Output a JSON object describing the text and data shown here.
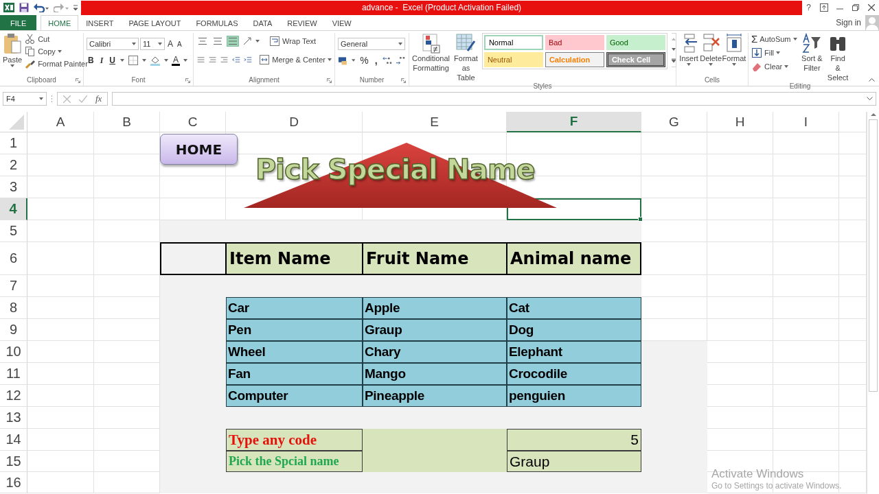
{
  "window": {
    "title": "advance -  Excel (Product Activation Failed)",
    "help": "?"
  },
  "ribbon_tabs": [
    {
      "label": "FILE",
      "kind": "file",
      "selected": false
    },
    {
      "label": "HOME",
      "kind": "tab",
      "selected": true
    },
    {
      "label": "INSERT",
      "kind": "tab",
      "selected": false
    },
    {
      "label": "PAGE LAYOUT",
      "kind": "tab",
      "selected": false
    },
    {
      "label": "FORMULAS",
      "kind": "tab",
      "selected": false
    },
    {
      "label": "DATA",
      "kind": "tab",
      "selected": false
    },
    {
      "label": "REVIEW",
      "kind": "tab",
      "selected": false
    },
    {
      "label": "VIEW",
      "kind": "tab",
      "selected": false
    }
  ],
  "account": {
    "label": "Sign in"
  },
  "clipboard": {
    "paste": "Paste",
    "cut": "Cut",
    "copy": "Copy",
    "format_painter": "Format Painter",
    "label": "Clipboard"
  },
  "font": {
    "name": "Calibri",
    "size": "11",
    "grow": "A",
    "shrink": "A",
    "bold": "B",
    "italic": "I",
    "underline": "U",
    "font_color": "A",
    "label": "Font"
  },
  "alignment": {
    "vertical_align": [
      {
        "selected": false
      },
      {
        "selected": false
      },
      {
        "selected": true
      }
    ],
    "wrap_text": "Wrap Text",
    "merge": "Merge & Center",
    "label": "Alignment"
  },
  "number": {
    "format": "General",
    "percent": "%",
    "comma": ",",
    "label": "Number"
  },
  "styles": {
    "conditional": "Conditional Formatting",
    "table": "Format as Table",
    "label": "Styles",
    "cells": [
      {
        "label": "Normal",
        "kind": "normal"
      },
      {
        "label": "Bad",
        "kind": "bad"
      },
      {
        "label": "Good",
        "kind": "good"
      },
      {
        "label": "Neutral",
        "kind": "neutral"
      },
      {
        "label": "Calculation",
        "kind": "calculation"
      },
      {
        "label": "Check Cell",
        "kind": "check"
      }
    ]
  },
  "cells_group": {
    "buttons": [
      "Insert",
      "Delete",
      "Format"
    ],
    "label": "Cells"
  },
  "editing": {
    "sigma": "Σ",
    "autosum": "AutoSum",
    "fill": "Fill",
    "clear": "Clear",
    "sort": "Sort & Filter",
    "find": "Find & Select",
    "label": "Editing"
  },
  "formula_bar": {
    "name_box": "F4",
    "fx": "fx"
  },
  "sheet": {
    "columns": [
      {
        "label": "A",
        "selected": false
      },
      {
        "label": "B",
        "selected": false
      },
      {
        "label": "C",
        "selected": false
      },
      {
        "label": "D",
        "selected": false
      },
      {
        "label": "E",
        "selected": false
      },
      {
        "label": "F",
        "selected": true
      },
      {
        "label": "G",
        "selected": false
      },
      {
        "label": "H",
        "selected": false
      },
      {
        "label": "I",
        "selected": false
      }
    ],
    "rows": [
      {
        "label": "1",
        "selected": false
      },
      {
        "label": "2",
        "selected": false
      },
      {
        "label": "3",
        "selected": false
      },
      {
        "label": "4",
        "selected": true
      },
      {
        "label": "5",
        "selected": false
      },
      {
        "label": "6",
        "selected": false
      },
      {
        "label": "7",
        "selected": false
      },
      {
        "label": "8",
        "selected": false
      },
      {
        "label": "9",
        "selected": false
      },
      {
        "label": "10",
        "selected": false
      },
      {
        "label": "11",
        "selected": false
      },
      {
        "label": "12",
        "selected": false
      },
      {
        "label": "13",
        "selected": false
      },
      {
        "label": "14",
        "selected": false
      },
      {
        "label": "15",
        "selected": false
      },
      {
        "label": "16",
        "selected": false
      }
    ],
    "home_button": "HOME",
    "banner": "Pick Special Name",
    "header_row": [
      "Item Name",
      "Fruit Name",
      "Animal name"
    ],
    "data_rows": [
      [
        "Car",
        "Apple",
        "Cat"
      ],
      [
        "Pen",
        "Graup",
        "Dog"
      ],
      [
        "Wheel",
        "Chary",
        "Elephant"
      ],
      [
        "Fan",
        "Mango",
        "Crocodile"
      ],
      [
        "Computer",
        "Pineapple",
        "penguien"
      ]
    ],
    "code_prompt": {
      "label": "Type any code",
      "value": "5"
    },
    "result": {
      "label": "Pick the Spcial name",
      "value": "Graup"
    }
  },
  "activation_notice": {
    "title": "Activate Windows",
    "message": "Go to Settings to activate Windows."
  }
}
